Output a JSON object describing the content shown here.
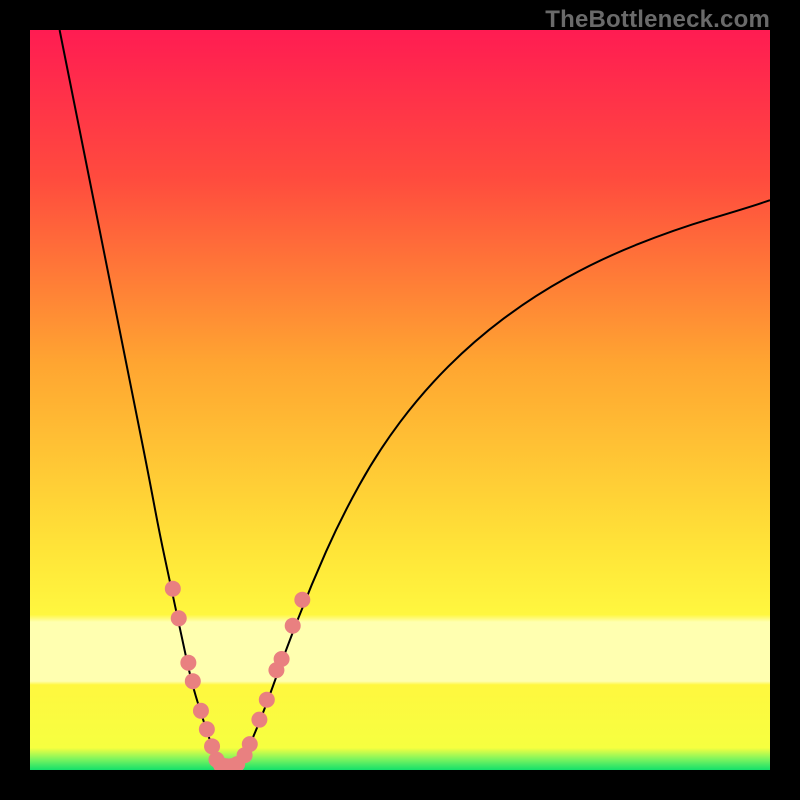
{
  "watermark": "TheBottleneck.com",
  "chart_data": {
    "type": "line",
    "title": "",
    "xlabel": "",
    "ylabel": "",
    "xlim": [
      0,
      1
    ],
    "ylim": [
      0,
      1
    ],
    "background_gradient": [
      {
        "stop": 0.0,
        "color": "#ff1c52"
      },
      {
        "stop": 0.2,
        "color": "#ff4b3e"
      },
      {
        "stop": 0.45,
        "color": "#ffa531"
      },
      {
        "stop": 0.7,
        "color": "#ffe438"
      },
      {
        "stop": 0.79,
        "color": "#fff73f"
      },
      {
        "stop": 0.8,
        "color": "#ffffb0"
      },
      {
        "stop": 0.88,
        "color": "#ffffb0"
      },
      {
        "stop": 0.885,
        "color": "#fff73f"
      },
      {
        "stop": 0.97,
        "color": "#f6ff40"
      },
      {
        "stop": 0.985,
        "color": "#7ff55e"
      },
      {
        "stop": 1.0,
        "color": "#13e06b"
      }
    ],
    "series": [
      {
        "name": "left-branch",
        "color": "#000000",
        "x": [
          0.04,
          0.06,
          0.08,
          0.1,
          0.12,
          0.14,
          0.16,
          0.175,
          0.19,
          0.205,
          0.218,
          0.23,
          0.24,
          0.248,
          0.253
        ],
        "y": [
          1.0,
          0.9,
          0.8,
          0.7,
          0.6,
          0.5,
          0.4,
          0.32,
          0.25,
          0.18,
          0.12,
          0.08,
          0.05,
          0.025,
          0.01
        ]
      },
      {
        "name": "valley-flat",
        "color": "#000000",
        "x": [
          0.253,
          0.26,
          0.268,
          0.276,
          0.285
        ],
        "y": [
          0.01,
          0.006,
          0.005,
          0.006,
          0.01
        ]
      },
      {
        "name": "right-branch",
        "color": "#000000",
        "x": [
          0.285,
          0.3,
          0.32,
          0.345,
          0.38,
          0.42,
          0.47,
          0.53,
          0.6,
          0.68,
          0.77,
          0.87,
          0.97,
          1.0
        ],
        "y": [
          0.01,
          0.04,
          0.09,
          0.16,
          0.25,
          0.34,
          0.43,
          0.51,
          0.58,
          0.64,
          0.69,
          0.73,
          0.76,
          0.77
        ]
      }
    ],
    "markers": {
      "name": "pink-dots",
      "color": "#e98080",
      "radius_px": 8,
      "points": [
        {
          "x": 0.193,
          "y": 0.245
        },
        {
          "x": 0.201,
          "y": 0.205
        },
        {
          "x": 0.214,
          "y": 0.145
        },
        {
          "x": 0.22,
          "y": 0.12
        },
        {
          "x": 0.231,
          "y": 0.08
        },
        {
          "x": 0.239,
          "y": 0.055
        },
        {
          "x": 0.246,
          "y": 0.032
        },
        {
          "x": 0.252,
          "y": 0.014
        },
        {
          "x": 0.258,
          "y": 0.007
        },
        {
          "x": 0.265,
          "y": 0.005
        },
        {
          "x": 0.272,
          "y": 0.005
        },
        {
          "x": 0.28,
          "y": 0.008
        },
        {
          "x": 0.29,
          "y": 0.02
        },
        {
          "x": 0.297,
          "y": 0.035
        },
        {
          "x": 0.31,
          "y": 0.068
        },
        {
          "x": 0.32,
          "y": 0.095
        },
        {
          "x": 0.333,
          "y": 0.135
        },
        {
          "x": 0.34,
          "y": 0.15
        },
        {
          "x": 0.355,
          "y": 0.195
        },
        {
          "x": 0.368,
          "y": 0.23
        }
      ]
    }
  }
}
